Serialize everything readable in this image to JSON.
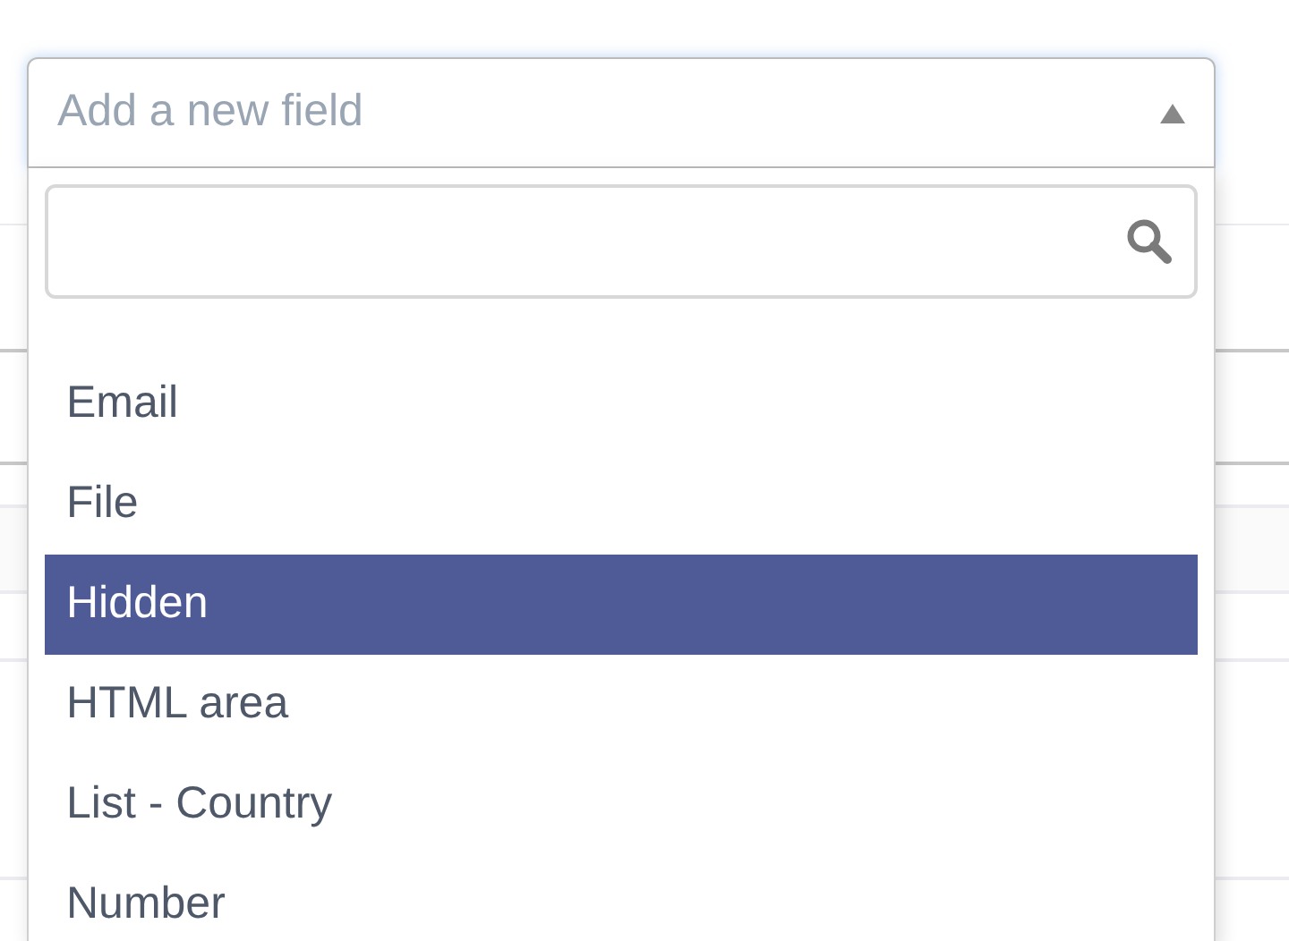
{
  "select": {
    "placeholder": "Add a new field",
    "expanded": true
  },
  "options": [
    {
      "label": "Email",
      "selected": false
    },
    {
      "label": "File",
      "selected": false
    },
    {
      "label": "Hidden",
      "selected": true
    },
    {
      "label": "HTML area",
      "selected": false
    },
    {
      "label": "List - Country",
      "selected": false
    },
    {
      "label": "Number",
      "selected": false
    }
  ]
}
